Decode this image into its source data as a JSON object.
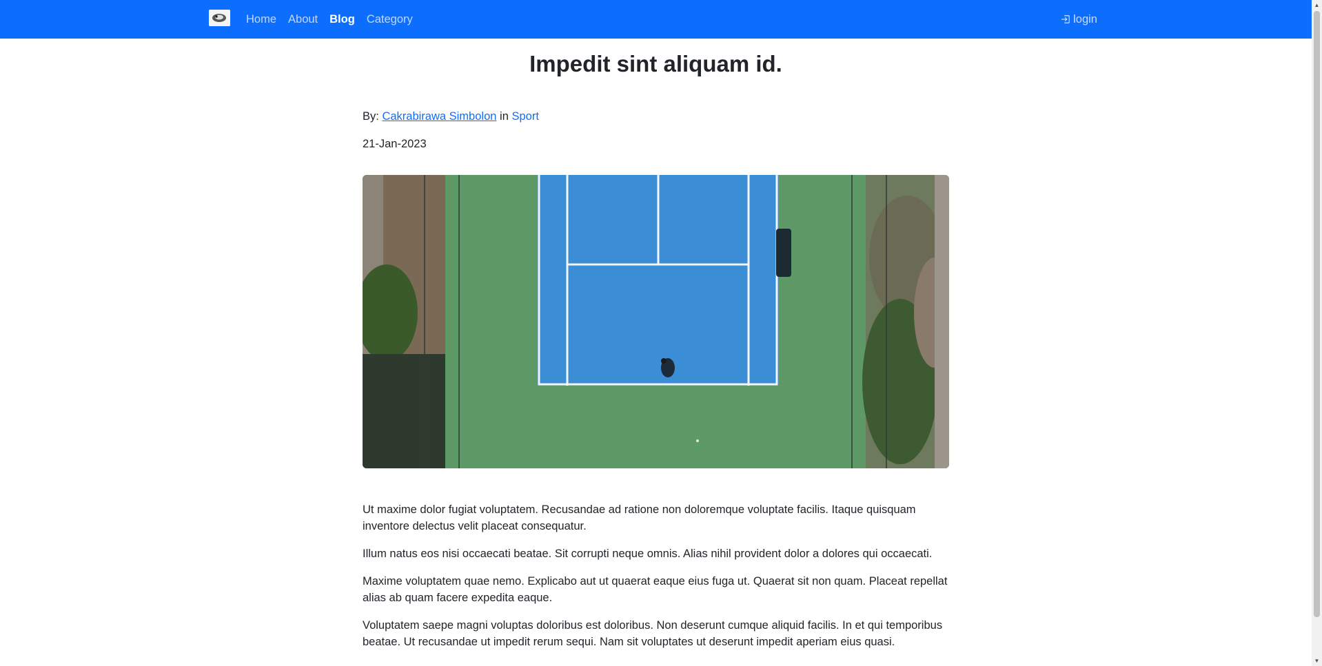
{
  "navbar": {
    "brand_logo": "brand-logo-icon",
    "links": [
      {
        "label": "Home",
        "active": false
      },
      {
        "label": "About",
        "active": false
      },
      {
        "label": "Blog",
        "active": true
      },
      {
        "label": "Category",
        "active": false
      }
    ],
    "login_label": "login",
    "login_icon": "login-icon",
    "background_color": "#0d6efd"
  },
  "post": {
    "title": "Impedit sint aliquam id.",
    "by_label": "By:",
    "author": "Cakrabirawa Simbolon",
    "in_label": "in",
    "category": "Sport",
    "date": "21-Jan-2023",
    "image": "tennis-court-aerial-photo",
    "paragraphs": [
      "Ut maxime dolor fugiat voluptatem. Recusandae ad ratione non doloremque voluptate facilis. Itaque quisquam inventore delectus velit placeat consequatur.",
      "Illum natus eos nisi occaecati beatae. Sit corrupti neque omnis. Alias nihil provident dolor a dolores qui occaecati.",
      "Maxime voluptatem quae nemo. Explicabo aut ut quaerat eaque eius fuga ut. Quaerat sit non quam. Placeat repellat alias ab quam facere expedita eaque.",
      "Voluptatem saepe magni voluptas doloribus est doloribus. Non deserunt cumque aliquid facilis. In et qui temporibus beatae. Ut recusandae ut impedit rerum sequi. Nam sit voluptates ut deserunt impedit aperiam eius quasi."
    ]
  },
  "colors": {
    "link": "#0d6efd",
    "text": "#212529",
    "court_blue": "#3b8ed6",
    "court_green": "#5f9e6b"
  }
}
